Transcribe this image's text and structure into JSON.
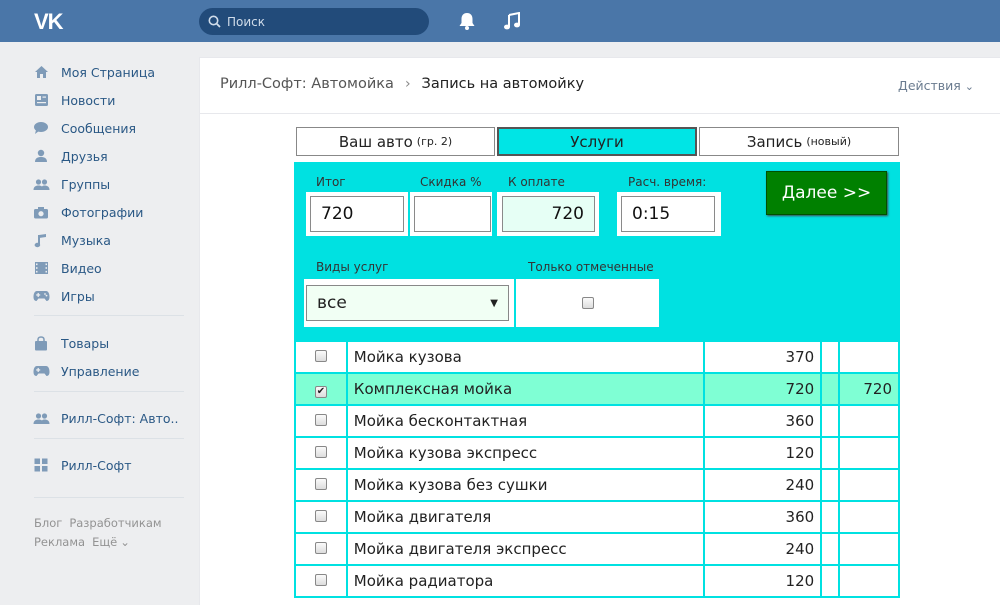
{
  "header": {
    "logo": "VK",
    "search_placeholder": "Поиск",
    "icons": [
      "bell-icon",
      "music-note-icon"
    ],
    "brand_color": "#4a76a8"
  },
  "sidebar": {
    "items": [
      {
        "label": "Моя Страница",
        "icon": "home-icon"
      },
      {
        "label": "Новости",
        "icon": "news-icon"
      },
      {
        "label": "Сообщения",
        "icon": "messages-icon"
      },
      {
        "label": "Друзья",
        "icon": "friend-icon"
      },
      {
        "label": "Группы",
        "icon": "groups-icon"
      },
      {
        "label": "Фотографии",
        "icon": "camera-icon"
      },
      {
        "label": "Музыка",
        "icon": "music-icon"
      },
      {
        "label": "Видео",
        "icon": "video-icon"
      },
      {
        "label": "Игры",
        "icon": "gamepad-icon"
      },
      {
        "label": "Товары",
        "icon": "bag-icon"
      },
      {
        "label": "Управление",
        "icon": "gamepad-icon"
      },
      {
        "label": "Рилл-Софт: Авто..",
        "icon": "groups-icon"
      },
      {
        "label": "Рилл-Софт",
        "icon": "apps-icon"
      }
    ],
    "footer": [
      "Блог",
      "Разработчикам",
      "Реклама",
      "Ещё"
    ]
  },
  "page": {
    "breadcrumb_parent": "Рилл-Софт: Автомойка",
    "breadcrumb_current": "Запись на автомойку",
    "actions_label": "Действия"
  },
  "tabs": [
    {
      "label": "Ваш авто",
      "suffix": "(гр. 2)",
      "active": false
    },
    {
      "label": "Услуги",
      "suffix": "",
      "active": true
    },
    {
      "label": "Запись",
      "suffix": "(новый)",
      "active": false
    }
  ],
  "form": {
    "total_label": "Итог",
    "total_value": "720",
    "discount_label": "Скидка %",
    "discount_value": "",
    "topay_label": "К оплате",
    "topay_value": "720",
    "time_label": "Расч. время:",
    "time_value": "0:15",
    "next_button": "Далее >>",
    "service_type_label": "Виды услуг",
    "service_type_value": "все",
    "only_checked_label": "Только отмеченные",
    "panel_color": "#00e1e1",
    "selected_row_color": "#7fffd4"
  },
  "services": [
    {
      "name": "Мойка кузова",
      "price": "370",
      "sum": "",
      "checked": false
    },
    {
      "name": "Комплексная мойка",
      "price": "720",
      "sum": "720",
      "checked": true
    },
    {
      "name": "Мойка бесконтактная",
      "price": "360",
      "sum": "",
      "checked": false
    },
    {
      "name": "Мойка кузова экспресс",
      "price": "120",
      "sum": "",
      "checked": false
    },
    {
      "name": "Мойка кузова без сушки",
      "price": "240",
      "sum": "",
      "checked": false
    },
    {
      "name": "Мойка двигателя",
      "price": "360",
      "sum": "",
      "checked": false
    },
    {
      "name": "Мойка двигателя экспресс",
      "price": "240",
      "sum": "",
      "checked": false
    },
    {
      "name": "Мойка радиатора",
      "price": "120",
      "sum": "",
      "checked": false
    }
  ]
}
